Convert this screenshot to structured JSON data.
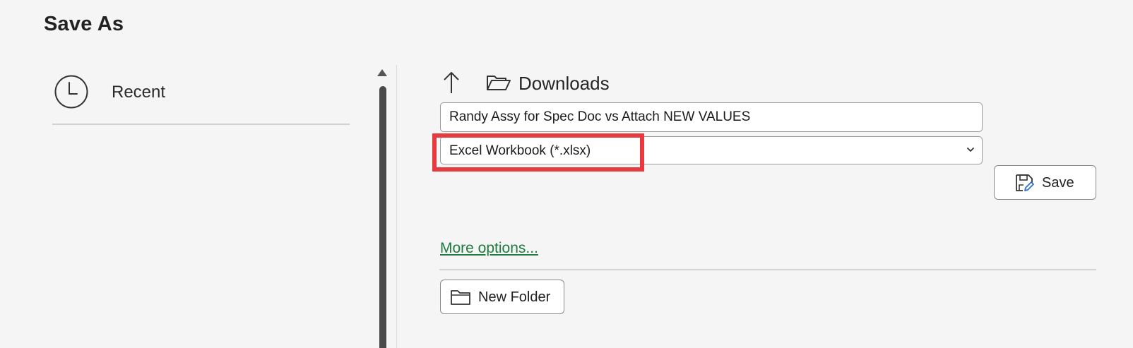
{
  "dialog": {
    "title": "Save As"
  },
  "sidebar": {
    "items": [
      {
        "label": "Recent",
        "icon": "clock-icon"
      }
    ]
  },
  "location": {
    "up_icon": "up-arrow-icon",
    "folder_icon": "folder-open-icon",
    "label": "Downloads"
  },
  "form": {
    "filename": "Randy Assy for Spec Doc vs Attach NEW VALUES",
    "filetype": "Excel Workbook (*.xlsx)",
    "save_label": "Save",
    "more_options_label": "More options...",
    "new_folder_label": "New Folder"
  },
  "colors": {
    "highlight": "#e83a3e",
    "link": "#1e7a3f",
    "background": "#f5f5f5"
  }
}
